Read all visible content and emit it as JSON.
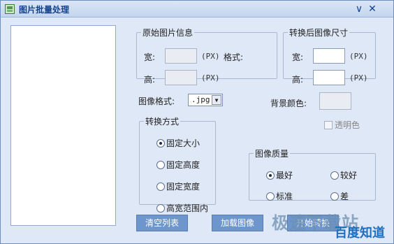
{
  "window": {
    "title": "图片批量处理",
    "minimize_symbol": "∨",
    "close_symbol": "✕"
  },
  "original_info": {
    "legend": "原始图片信息",
    "width_label": "宽:",
    "width_unit": "(PX)",
    "format_label": "格式:",
    "height_label": "高:",
    "height_unit": "(PX)"
  },
  "target_size": {
    "legend": "转换后图像尺寸",
    "width_label": "宽:",
    "width_unit": "(PX)",
    "height_label": "高:",
    "height_unit": "(PX)"
  },
  "image_format": {
    "label": "图像格式:",
    "selected": ".jpg"
  },
  "background": {
    "label": "背景颜色:",
    "transparent_label": "透明色"
  },
  "convert_mode": {
    "legend": "转换方式",
    "options": [
      "固定大小",
      "固定高度",
      "固定宽度",
      "高宽范围内"
    ],
    "selected_index": 0
  },
  "quality": {
    "legend": "图像质量",
    "options": [
      "最好",
      "较好",
      "标准",
      "差"
    ],
    "selected_index": 0
  },
  "buttons": {
    "clear_list": "清空列表",
    "load_image": "加载图像",
    "start": "开始转换"
  },
  "watermark": {
    "line1": "极速下载站",
    "line2": "百度知道"
  },
  "colors": {
    "accent": "#6f96cc",
    "window_bg": "#dfe8f6",
    "title_text": "#15428b"
  }
}
